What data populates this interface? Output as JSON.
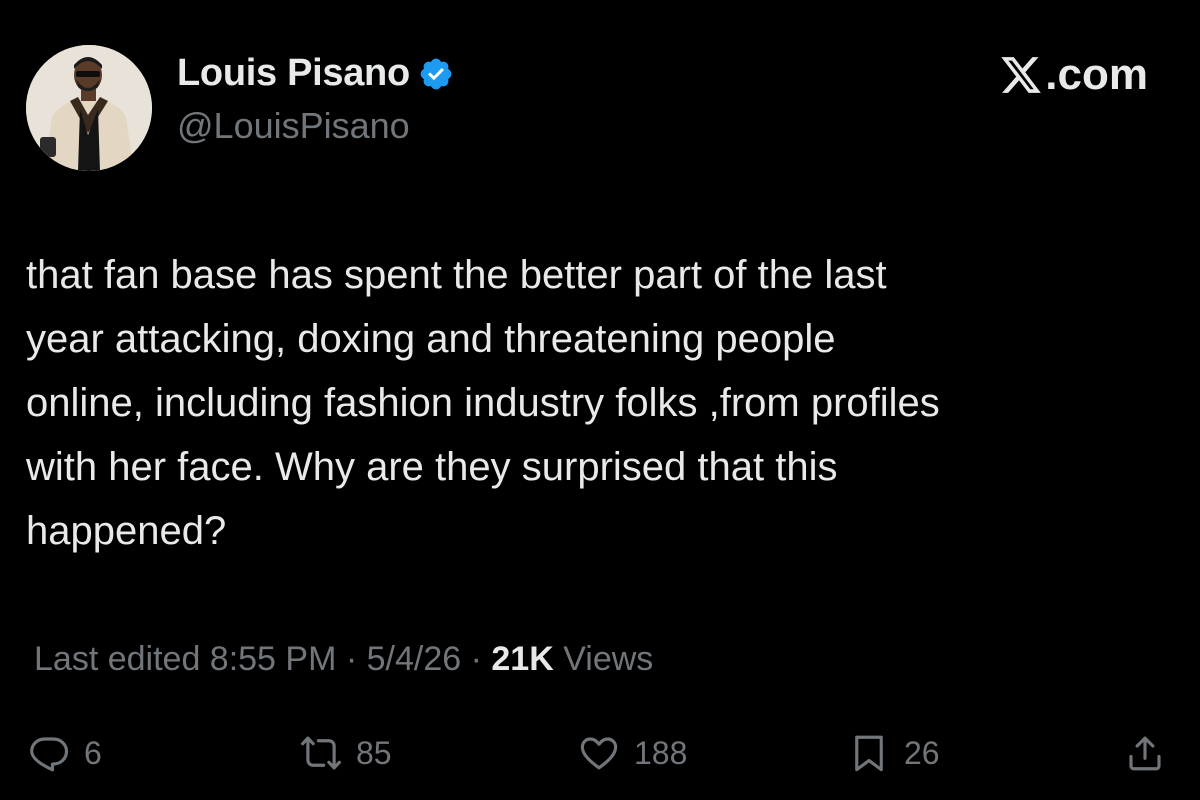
{
  "header": {
    "display_name": "Louis Pisano",
    "handle": "@LouisPisano",
    "brand": ".com"
  },
  "tweet": {
    "text": "that fan base has spent the better part of the last\nyear attacking, doxing and threatening people\nonline, including fashion industry folks ,from profiles\nwith her face. Why are they surprised that this\nhappened?"
  },
  "meta": {
    "edited_label": "Last edited 8:55 PM",
    "separator": " · ",
    "date": "5/4/26",
    "views_count": "21K",
    "views_label": " Views"
  },
  "actions": {
    "replies": "6",
    "reposts": "85",
    "likes": "188",
    "bookmarks": "26"
  },
  "colors": {
    "background": "#000000",
    "text_primary": "#e7e9ea",
    "text_secondary": "#71767b",
    "verified": "#1d9bf0"
  },
  "icons": {
    "verified": "verified-badge-icon",
    "brand": "x-logo-icon",
    "reply": "reply-icon",
    "repost": "repost-icon",
    "like": "heart-icon",
    "bookmark": "bookmark-icon",
    "share": "share-icon"
  }
}
